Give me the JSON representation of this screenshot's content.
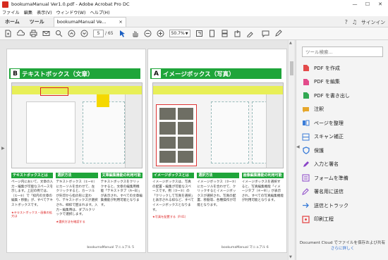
{
  "window": {
    "title": "bookumaManual Ver1.0.pdf - Adobe Acrobat Pro DC",
    "controls": [
      "—",
      "☐",
      "✕"
    ]
  },
  "menu": [
    "ファイル",
    "編集",
    "表示(V)",
    "ウィンドウ(W)",
    "ヘルプ(H)"
  ],
  "tabs": {
    "home": "ホーム",
    "tools": "ツール",
    "document": "bookumaManual Ve...",
    "document_close": "×",
    "signin": "サインイン"
  },
  "toolbar": {
    "page_current": "5",
    "page_total": "/ 65",
    "zoom": "50.7%"
  },
  "pages": {
    "left": {
      "letter": "B",
      "title": "テキストボックス（文章）",
      "columns": [
        {
          "head": "テキストボックスとは",
          "body": "ページ内において、文章の入力・編集が可能なスペースを示します。上記の例では、（①~⑥）で「枠内の文章の編集・移動」が、すべてテキストボックスです。",
          "note": "★テキストボックス・画像の拡大は"
        },
        {
          "head": "選択方法",
          "body": "テキストボックス（①~⑥）にカーソルを合わせて、左クリックすると、カーソルが矢印から指の形に変わり、テキストボックスが選択され、緑枠で囲まれます。入力・編集時は、ダブルクリックで選択します。",
          "note": "★選択方法を確認する"
        },
        {
          "head": "文章編集機能の利用可能に",
          "body": "テキストボックスをクリックすると、文章の編集用機能「テキストタブ（A~B）」が表示され、すべての文章編集機能が利用可能となります。",
          "note": ""
        }
      ],
      "footer": "bookumaManual マニュアル  5"
    },
    "right": {
      "letter": "A",
      "title": "イメージボックス（写真）",
      "columns": [
        {
          "head": "イメージボックスとは",
          "body": "イメージボックスは、写真の配置・編集が可能なスペースです。例（③~⑤）の「クリックして写真を選択」と表示される枠など、すべてイメージボックスとなります。",
          "note": "★写真を配置する（P.41）"
        },
        {
          "head": "選択方法",
          "body": "イメージボックス（③~⑤）にカーソルを合わせて、クリックするとイメージボックスが選択され、写真の配置、移動等、各種操作が可能となります。",
          "note": ""
        },
        {
          "head": "画像編集機能の利用可能に",
          "body": "イメージボックスを選択すると、写真編集機能「イメージタブ（④~⑧）」が表示され、すべての写真編集機能が利用可能となります。",
          "note": ""
        }
      ],
      "footer": "bookumaManual マニュアル  6"
    }
  },
  "right_pane": {
    "search_placeholder": "ツール検索...",
    "tools": [
      {
        "label": "PDF を作成",
        "icon": "create-pdf-icon",
        "color": "#e34b4b"
      },
      {
        "label": "PDF を編集",
        "icon": "edit-pdf-icon",
        "color": "#e34b8a"
      },
      {
        "label": "PDF を書き出し",
        "icon": "export-pdf-icon",
        "color": "#32a852"
      },
      {
        "label": "注釈",
        "icon": "comment-icon",
        "color": "#e6a72b"
      },
      {
        "label": "ページを整理",
        "icon": "organize-pages-icon",
        "color": "#3b7dd8"
      },
      {
        "label": "スキャン補正",
        "icon": "scan-icon",
        "color": "#3b7dd8"
      },
      {
        "label": "保護",
        "icon": "protect-icon",
        "color": "#3b7dd8"
      },
      {
        "label": "入力と署名",
        "icon": "fill-sign-icon",
        "color": "#8a44c7"
      },
      {
        "label": "フォームを準備",
        "icon": "prepare-form-icon",
        "color": "#8a44c7"
      },
      {
        "label": "署名用に送信",
        "icon": "send-sign-icon",
        "color": "#8a44c7"
      },
      {
        "label": "送信とトラック",
        "icon": "send-track-icon",
        "color": "#3b7dd8"
      },
      {
        "label": "印刷工程",
        "icon": "print-production-icon",
        "color": "#e34b4b"
      }
    ],
    "cloud_note": "Document Cloud でファイルを保存および共有",
    "cloud_link": "さらに詳しく"
  },
  "colors": {
    "accent_green": "#1fa53a",
    "highlight_yellow": "#f5d800",
    "link_blue": "#2a6bd1"
  }
}
